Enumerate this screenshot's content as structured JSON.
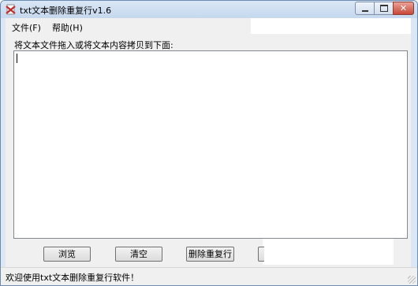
{
  "window": {
    "title": "txt文本删除重复行v1.6",
    "close_glyph": "✕"
  },
  "menu": {
    "items": [
      {
        "label": "文件(F)"
      },
      {
        "label": "帮助(H)"
      }
    ]
  },
  "instruction": "将文本文件拖入或将文本内容拷贝到下面:",
  "textarea": {
    "value": ""
  },
  "buttons": {
    "browse": "浏览",
    "clear": "清空",
    "remove_duplicates": "删除重复行"
  },
  "status": {
    "text": "欢迎使用txt文本删除重复行软件！"
  },
  "colors": {
    "title_gradient_top": "#d9e6f5",
    "close_button": "#c9483a",
    "client_bg": "#f0f0f0"
  },
  "icons": {
    "app": "txt-app-icon",
    "minimize": "minimize-icon",
    "maximize": "maximize-icon",
    "close": "close-icon"
  }
}
